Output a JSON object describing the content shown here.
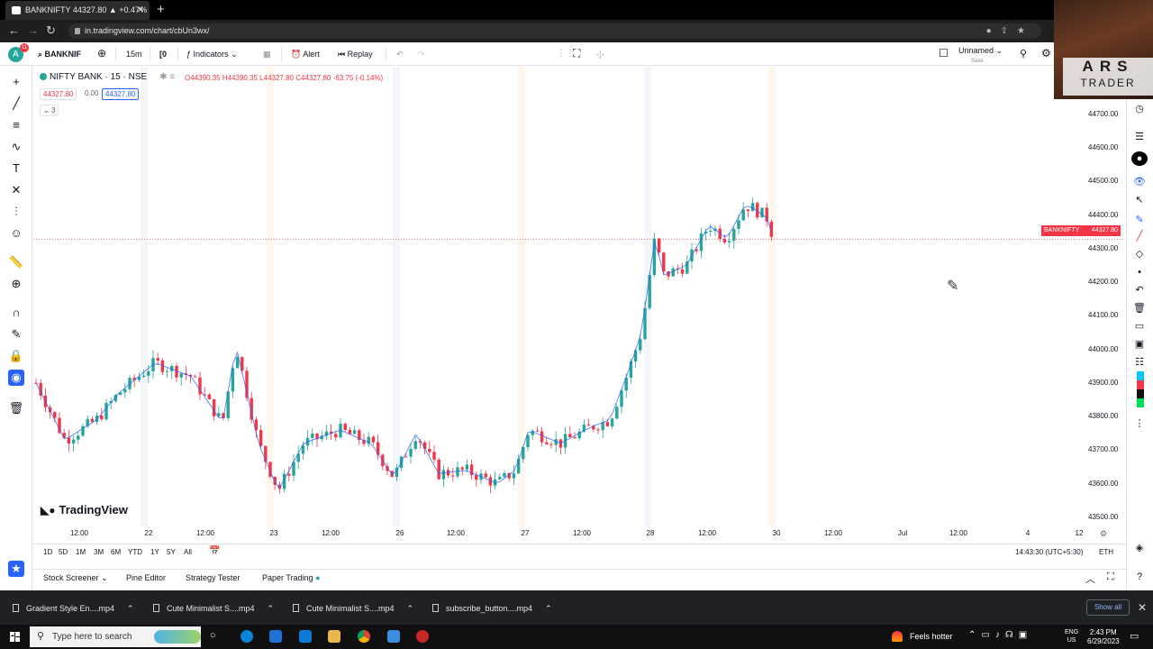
{
  "browser": {
    "tab_title": "BANKNIFTY 44327.80 ▲ +0.47%",
    "url": "in.tradingview.com/chart/cbUn3wx/"
  },
  "webcam": {
    "line1": "ARS",
    "line2": "TRADER"
  },
  "toolbar": {
    "symbol": "BANKNIF",
    "interval": "15m",
    "indicators": "Indicators",
    "alert": "Alert",
    "replay": "Replay",
    "layout_name": "Unnamed",
    "layout_sub": "Save",
    "avatar_badge": "11"
  },
  "legend": {
    "symbol_line": "NIFTY BANK · 15 · NSE",
    "ohlc": "O44390.35 H44390.35 L44327.80 C44327.80 -63.75 (-0.14%)",
    "bid": "44327.80",
    "spread": "0.00",
    "ask": "44327.80",
    "indicator_count": "3"
  },
  "chart_data": {
    "type": "candlestick",
    "symbol": "NIFTY BANK",
    "interval": "15",
    "exchange": "NSE",
    "current_price": 44327.8,
    "price_label": "BANKNIFTY",
    "ylim": [
      43470,
      44740
    ],
    "y_ticks": [
      "44700.00",
      "44600.00",
      "44500.00",
      "44400.00",
      "44300.00",
      "44200.00",
      "44100.00",
      "44000.00",
      "43900.00",
      "43800.00",
      "43700.00",
      "43600.00",
      "43500.00"
    ],
    "x_ticks": [
      "12:00",
      "22",
      "12:00",
      "23",
      "12:00",
      "26",
      "12:00",
      "27",
      "12:00",
      "28",
      "12:00",
      "30",
      "12:00",
      "Jul",
      "12:00",
      "4",
      "12"
    ],
    "day_closes": [
      {
        "day": "21",
        "close": 43870
      },
      {
        "day": "22",
        "close": 43760
      },
      {
        "day": "23",
        "close": 43640
      },
      {
        "day": "26",
        "close": 43600
      },
      {
        "day": "27",
        "close": 43780
      },
      {
        "day": "28",
        "close": 44320
      },
      {
        "day": "30",
        "close": 44327.8
      }
    ]
  },
  "brand": "TradingView",
  "ranges": [
    "1D",
    "5D",
    "1M",
    "3M",
    "6M",
    "YTD",
    "1Y",
    "5Y",
    "All"
  ],
  "clock": "14:43:30 (UTC+5:30)",
  "session": "ETH",
  "bottom_tabs": [
    "Stock Screener",
    "Pine Editor",
    "Strategy Tester",
    "Paper Trading"
  ],
  "downloads": [
    "Gradient Style En....mp4",
    "Cute Minimalist S....mp4",
    "Cute Minimalist S....mp4",
    "subscribe_button....mp4"
  ],
  "show_all": "Show all",
  "taskbar": {
    "search_placeholder": "Type here to search",
    "weather": "Feels hotter",
    "lang1": "ENG",
    "lang2": "US",
    "time": "2:43 PM",
    "date": "6/29/2023"
  },
  "colors": {
    "up": "#26a69a",
    "down": "#f23645",
    "accent": "#2962ff",
    "ma": "#2962ff"
  }
}
